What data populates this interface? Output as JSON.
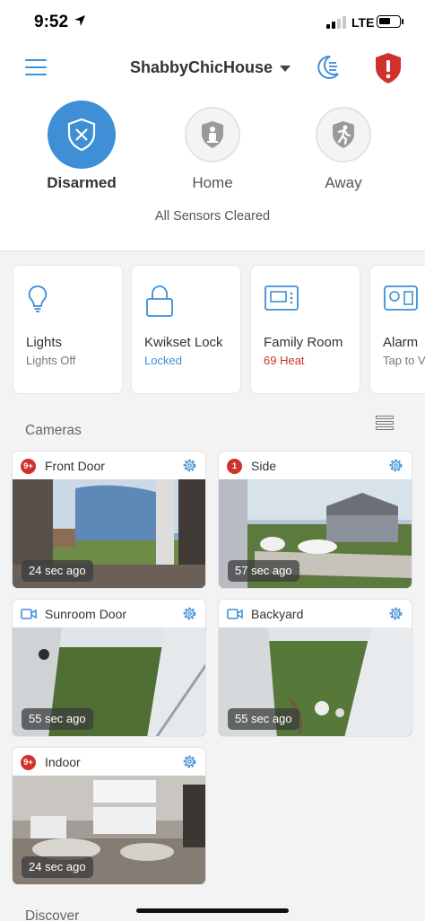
{
  "status_bar": {
    "time": "9:52",
    "network": "LTE"
  },
  "header": {
    "location_name": "ShabbyChicHouse",
    "modes": [
      {
        "label": "Disarmed",
        "active": true
      },
      {
        "label": "Home",
        "active": false
      },
      {
        "label": "Away",
        "active": false
      }
    ],
    "sensors_status": "All Sensors Cleared"
  },
  "devices": [
    {
      "name": "Lights",
      "status": "Lights Off",
      "icon": "lightbulb-icon"
    },
    {
      "name": "Kwikset Lock",
      "status": "Locked",
      "icon": "lock-icon"
    },
    {
      "name": "Family Room",
      "status": "69 Heat",
      "icon": "thermostat-icon"
    },
    {
      "name": "Alarm",
      "status": "Tap to V",
      "icon": "alarm-panel-icon"
    }
  ],
  "cameras": {
    "title": "Cameras",
    "items": [
      {
        "name": "Front Door",
        "badge": "9+",
        "time": "24 sec ago"
      },
      {
        "name": "Side",
        "badge": "1",
        "time": "57 sec ago"
      },
      {
        "name": "Sunroom Door",
        "badge": "",
        "time": "55 sec ago"
      },
      {
        "name": "Backyard",
        "badge": "",
        "time": "55 sec ago"
      },
      {
        "name": "Indoor",
        "badge": "9+",
        "time": "24 sec ago"
      }
    ]
  },
  "discover_title": "Discover",
  "colors": {
    "accent": "#3e8fd6",
    "alert": "#d0312d"
  }
}
